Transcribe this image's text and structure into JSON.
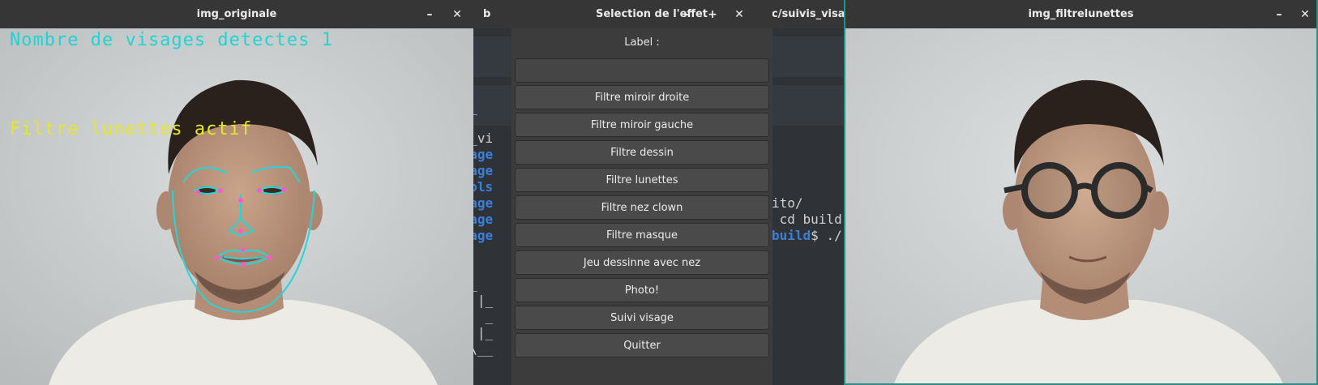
{
  "terminal": {
    "title_left": "b",
    "title_right": "c/suivis_visage",
    "lines": [
      {
        "text": "is_",
        "blue": false
      },
      {
        "text": "is_vi",
        "blue": false
      },
      {
        "text": "isage",
        "blue": true
      },
      {
        "text": "isage",
        "blue": true
      },
      {
        "text": "tools",
        "blue": true
      },
      {
        "text": "isage",
        "blue": true
      },
      {
        "text": "isage",
        "blue": true
      },
      {
        "text": "isage",
        "blue": true
      }
    ],
    "right_lines": [
      {
        "text": "ito/",
        "blue": false
      },
      {
        "text": " cd build",
        "blue": false
      },
      {
        "text": "build",
        "blue": true,
        "suffix": "$ ./"
      }
    ],
    "ascii": [
      "  _",
      " | |_",
      "\\|  _",
      " | |_",
      "/ \\__"
    ]
  },
  "win_orig": {
    "title": "img_originale",
    "minimize": "–",
    "close": "✕",
    "overlay_faces": "Nombre de visages detectes 1",
    "overlay_filter": "Filtre lunettes actif",
    "overlay_faces_color": "#22d3d3",
    "overlay_filter_color": "#e6e62a"
  },
  "win_filt": {
    "title": "img_filtrelunettes",
    "minimize": "–",
    "close": "✕"
  },
  "dialog": {
    "title": "Selection de l'effet",
    "minimize": "–",
    "maximize": "+",
    "close": "✕",
    "label": "Label :",
    "input_value": "",
    "buttons": [
      "Filtre miroir droite",
      "Filtre miroir gauche",
      "Filtre dessin",
      "Filtre lunettes",
      "Filtre nez clown",
      "Filtre masque",
      "Jeu dessinne avec nez",
      "Photo!",
      "Suivi visage",
      "Quitter"
    ]
  },
  "colors": {
    "landmark_line": "#25d6d6",
    "landmark_point": "#ff5ac8",
    "accent_border": "#2e8c86"
  }
}
